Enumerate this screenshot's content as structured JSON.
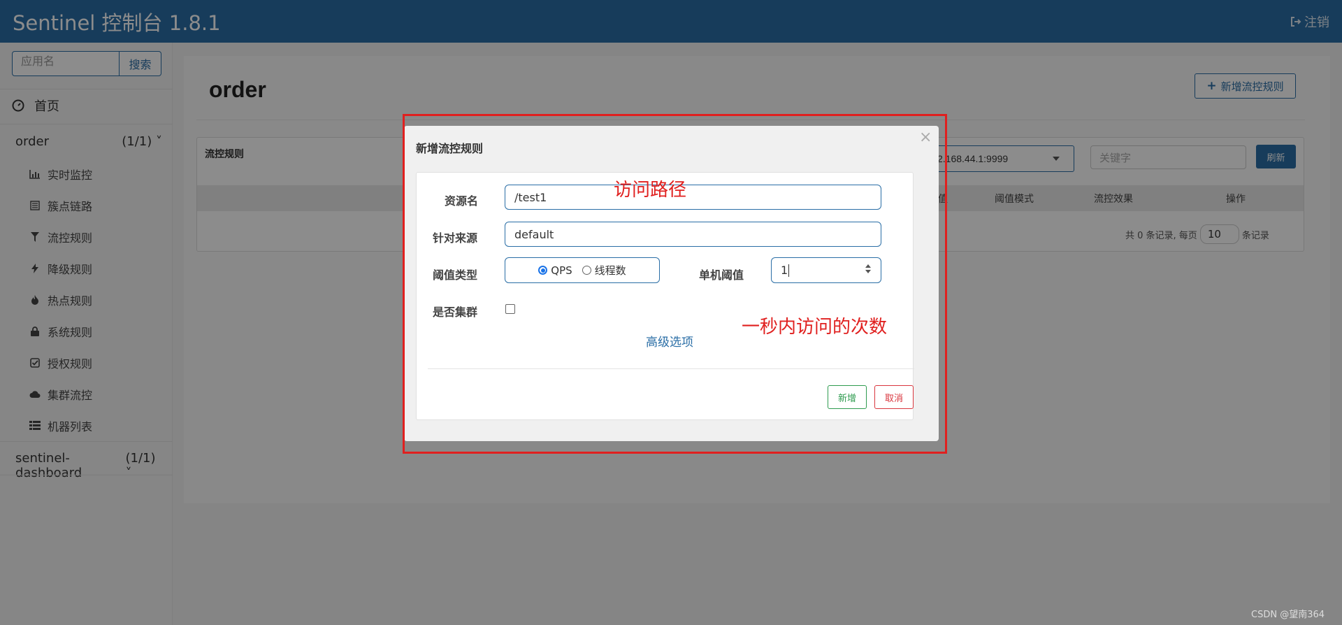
{
  "navbar": {
    "brand": "Sentinel 控制台 1.8.1",
    "logout_label": "注销"
  },
  "sidebar": {
    "search_placeholder": "应用名",
    "search_button": "搜索",
    "home_label": "首页",
    "apps": [
      {
        "name": "order",
        "count": "(1/1)"
      },
      {
        "name": "sentinel-dashboard",
        "count": "(1/1)"
      }
    ],
    "items": [
      {
        "label": "实时监控",
        "icon": "bar-chart-icon"
      },
      {
        "label": "簇点链路",
        "icon": "list-icon"
      },
      {
        "label": "流控规则",
        "icon": "filter-icon"
      },
      {
        "label": "降级规则",
        "icon": "flash-icon"
      },
      {
        "label": "热点规则",
        "icon": "fire-icon"
      },
      {
        "label": "系统规则",
        "icon": "lock-icon"
      },
      {
        "label": "授权规则",
        "icon": "check-icon"
      },
      {
        "label": "集群流控",
        "icon": "cloud-icon"
      },
      {
        "label": "机器列表",
        "icon": "th-list-icon"
      }
    ]
  },
  "main": {
    "title": "order",
    "add_rule_button": "新增流控规则",
    "panel_title": "流控规则",
    "machine_value": "2.168.44.1:9999",
    "keyword_placeholder": "关键字",
    "refresh_button": "刷新",
    "columns": [
      "值",
      "阈值模式",
      "流控效果",
      "操作"
    ],
    "pager": {
      "total_prefix": "共 0 条记录, 每页",
      "page_size": "10",
      "suffix": "条记录"
    }
  },
  "modal": {
    "title": "新增流控规则",
    "close": "×",
    "resource_label": "资源名",
    "resource_value": "/test1",
    "source_label": "针对来源",
    "source_value": "default",
    "threshold_type_label": "阈值类型",
    "options": [
      "QPS",
      "线程数"
    ],
    "selected_option": "QPS",
    "single_threshold_label": "单机阈值",
    "single_threshold_value": "1",
    "cluster_label": "是否集群",
    "advanced_link": "高级选项",
    "add_button": "新增",
    "cancel_button": "取消"
  },
  "annotations": {
    "path_note": "访问路径",
    "count_note": "一秒内访问的次数",
    "color": "#e0201f"
  },
  "watermark": "CSDN @望南364"
}
